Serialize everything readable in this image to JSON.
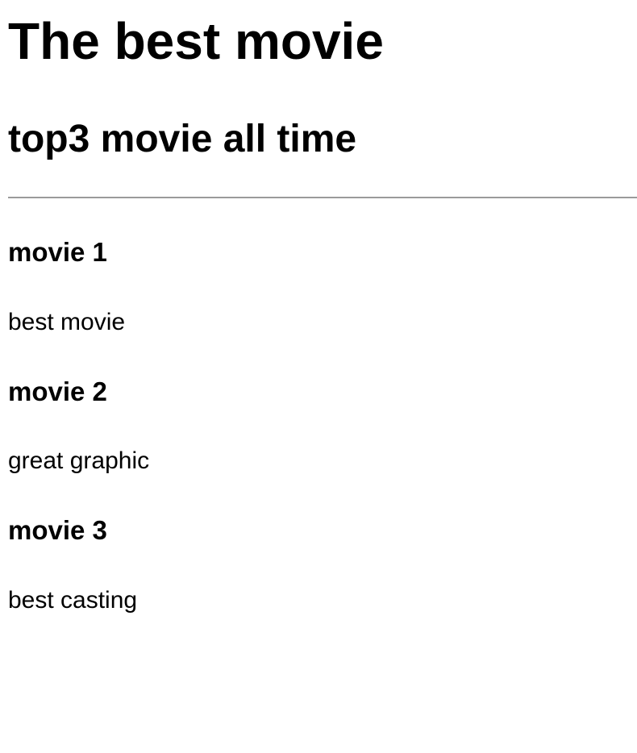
{
  "page": {
    "title": "The best movie",
    "subtitle": "top3 movie all time"
  },
  "movies": [
    {
      "title": "movie 1",
      "description": "best movie"
    },
    {
      "title": "movie 2",
      "description": "great graphic"
    },
    {
      "title": "movie 3",
      "description": "best casting"
    }
  ],
  "colors": {
    "text": "#000000",
    "rule": "#9a9a9a",
    "background": "#ffffff"
  }
}
